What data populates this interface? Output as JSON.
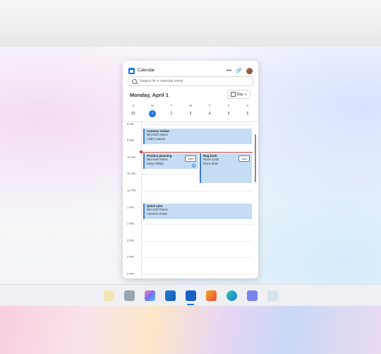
{
  "app": {
    "title": "Calendar"
  },
  "search": {
    "placeholder": "Search for a calendar event"
  },
  "header": {
    "date": "Monday, April 1",
    "view": "Day"
  },
  "week": {
    "days": [
      {
        "dow": "S",
        "num": "31"
      },
      {
        "dow": "M",
        "num": "1",
        "selected": true
      },
      {
        "dow": "T",
        "num": "2"
      },
      {
        "dow": "W",
        "num": "3"
      },
      {
        "dow": "T",
        "num": "4"
      },
      {
        "dow": "F",
        "num": "5"
      },
      {
        "dow": "S",
        "num": "6"
      }
    ]
  },
  "hours": [
    "8 AM",
    "9 AM",
    "10 AM",
    "11 AM",
    "12 PM",
    "1 PM",
    "2 PM",
    "3 PM",
    "4 PM",
    "5 PM"
  ],
  "events": {
    "contoso": {
      "title": "Contoso review",
      "line1": "Microsoft Teams",
      "line2": "Andre Lawson"
    },
    "product": {
      "title": "Product planning",
      "line1": "Microsoft Teams",
      "line2": "Daisy Phillips",
      "join": "Join"
    },
    "bugbash": {
      "title": "Bug bash",
      "line1": "Room 21/32",
      "line2": "Bruno Zhao",
      "join": "Join"
    },
    "quicksync": {
      "title": "Quick sync",
      "line1": "Microsoft Teams",
      "line2": "Cameron Evans"
    }
  },
  "taskbar": {
    "apps": [
      "widgets",
      "file-explorer",
      "photos",
      "outlook",
      "calendar",
      "office",
      "edge",
      "teams",
      "system"
    ]
  },
  "colors": {
    "accent": "#1a73e8",
    "event_fill": "#c4ddf4",
    "now_line": "#c23b3b"
  }
}
